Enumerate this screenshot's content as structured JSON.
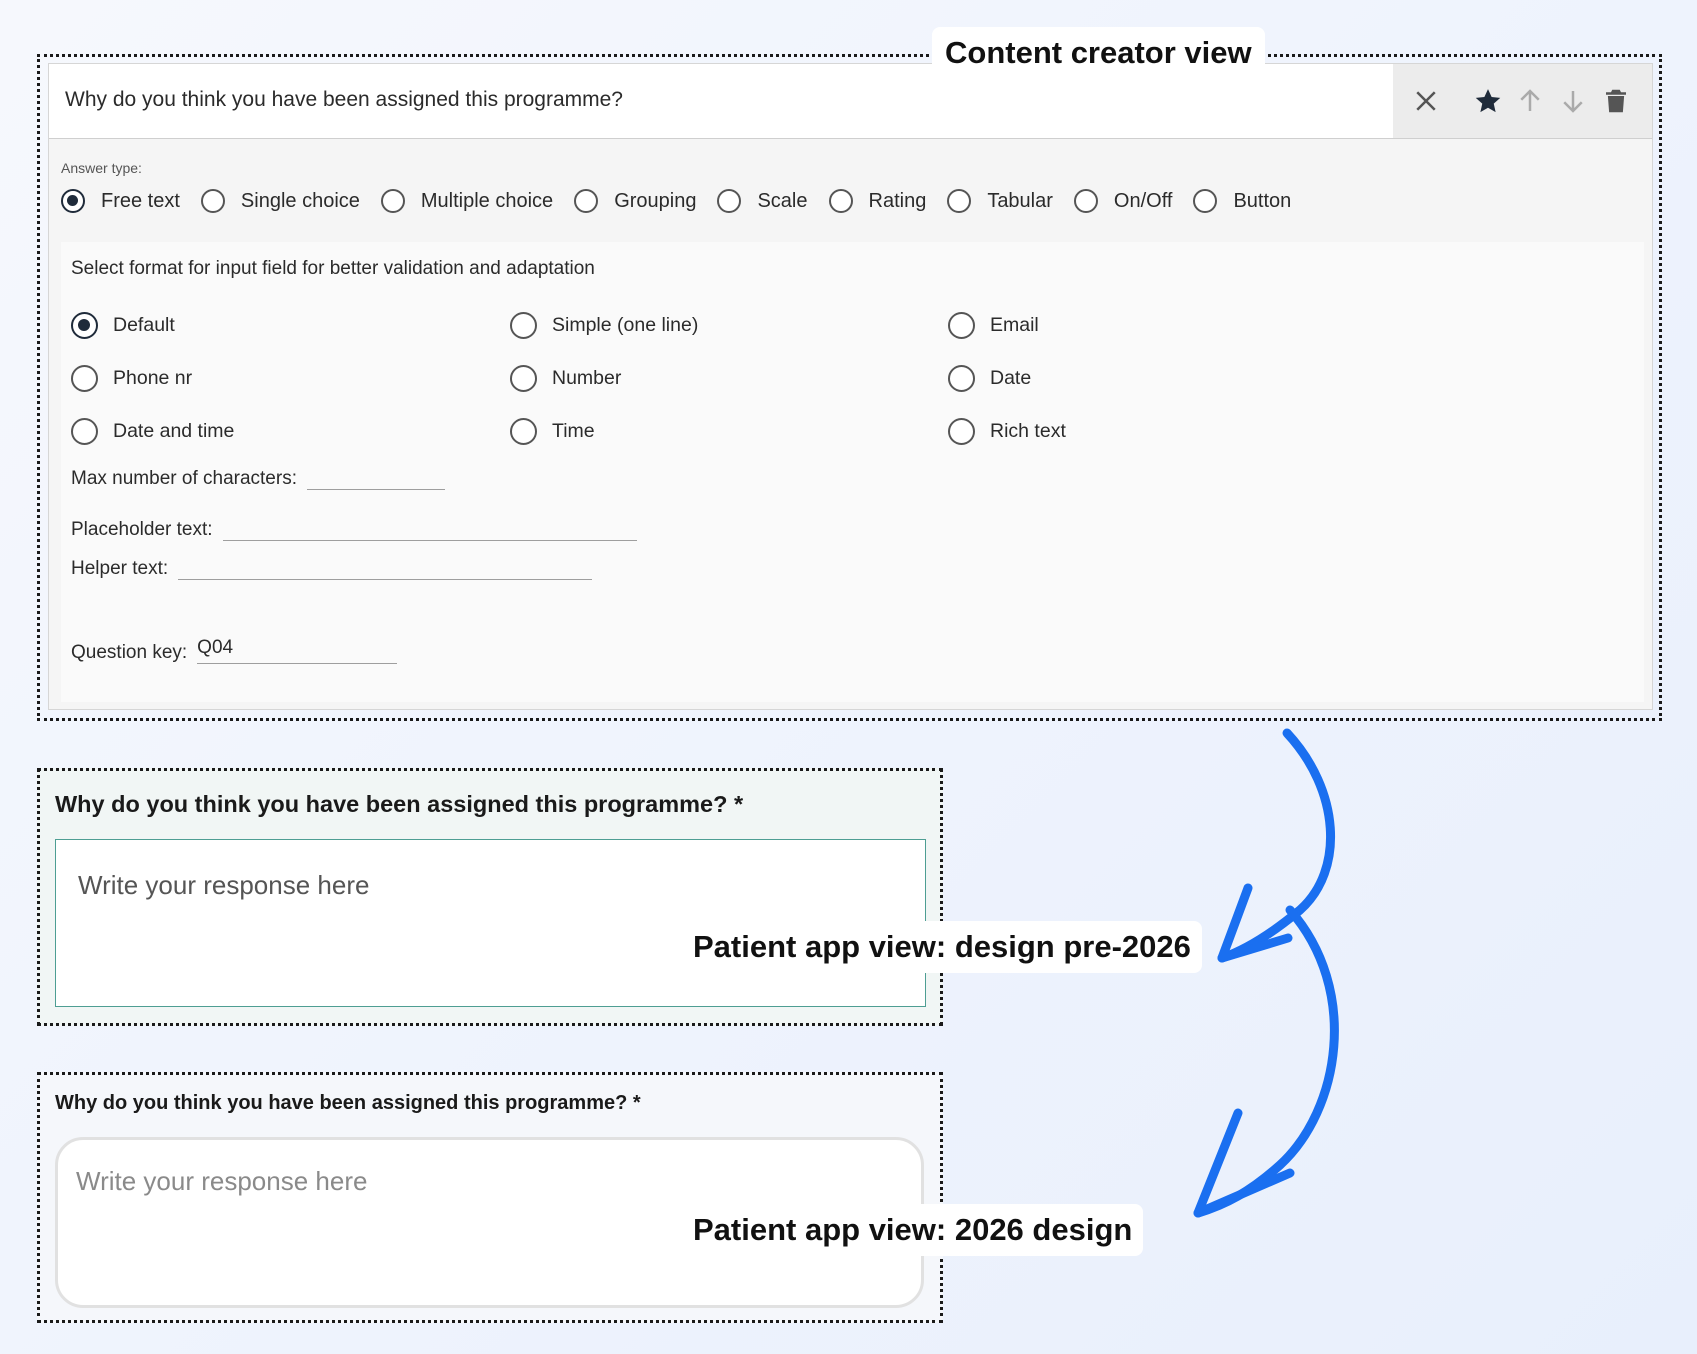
{
  "creator": {
    "label": "Content creator view",
    "question": "Why do you think you have been assigned this programme?",
    "toolbar": {
      "close_icon": "close-icon",
      "star_icon": "star-icon",
      "up_icon": "arrow-up-icon",
      "down_icon": "arrow-down-icon",
      "delete_icon": "trash-icon"
    },
    "answer_type_label": "Answer type:",
    "answer_types": [
      "Free text",
      "Single choice",
      "Multiple choice",
      "Grouping",
      "Scale",
      "Rating",
      "Tabular",
      "On/Off",
      "Button"
    ],
    "answer_type_selected": "Free text",
    "format_title": "Select format for input field for better validation and adaptation",
    "formats": [
      "Default",
      "Simple (one line)",
      "Email",
      "Phone nr",
      "Number",
      "Date",
      "Date and time",
      "Time",
      "Rich text"
    ],
    "format_selected": "Default",
    "max_chars_label": "Max number of characters:",
    "max_chars_value": "",
    "placeholder_label": "Placeholder text:",
    "placeholder_value": "",
    "helper_label": "Helper text:",
    "helper_value": "",
    "question_key_label": "Question key:",
    "question_key_value": "Q04"
  },
  "pre2026": {
    "label": "Patient app view: design pre-2026",
    "question": "Why do you think you have been assigned this programme? *",
    "placeholder": "Write your response here",
    "accent_color": "#4e9e93"
  },
  "design2026": {
    "label": "Patient app view: 2026 design",
    "question": "Why do you think you have been assigned this programme? *",
    "placeholder": "Write your response here",
    "border_color": "#e1e1e1"
  },
  "arrow_color": "#1a6ff0"
}
